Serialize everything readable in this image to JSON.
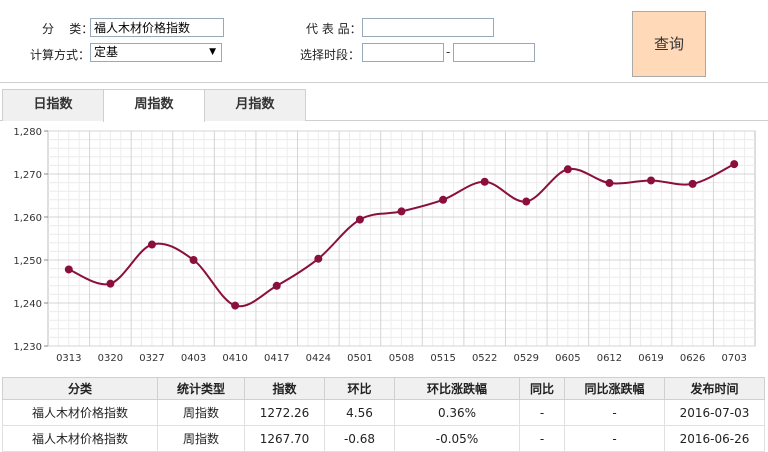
{
  "filters": {
    "category_label": "分    类：",
    "category_value": "福人木材价格指数",
    "method_label": "计算方式：",
    "method_value": "定基",
    "representative_label": "代 表 品：",
    "representative_value": "",
    "period_label": "选择时段：",
    "period_start": "",
    "period_separator": "-",
    "period_end": "",
    "query_button": "查询"
  },
  "tabs": [
    {
      "label": "日指数",
      "active": false
    },
    {
      "label": "周指数",
      "active": true
    },
    {
      "label": "月指数",
      "active": false
    }
  ],
  "colors": {
    "series_line": "#8b0f3c",
    "series_marker": "#8b0f3c",
    "grid": "#d4d4d4",
    "up": "#d9001b",
    "down": "#2f8a2f",
    "query_button_bg": "#ffd9b8"
  },
  "chart_data": {
    "type": "line",
    "x": [
      "0313",
      "0320",
      "0327",
      "0403",
      "0410",
      "0417",
      "0424",
      "0501",
      "0508",
      "0515",
      "0522",
      "0529",
      "0605",
      "0612",
      "0619",
      "0626",
      "0703"
    ],
    "series": [
      {
        "values": [
          1247.8,
          1244.5,
          1253.6,
          1250.0,
          1239.4,
          1244.0,
          1250.3,
          1259.4,
          1261.3,
          1264.0,
          1268.2,
          1263.6,
          1271.1,
          1267.9,
          1268.5,
          1267.7,
          1272.3
        ]
      }
    ],
    "ylim": [
      1230,
      1280
    ],
    "yticks": [
      "1,230",
      "1,240",
      "1,250",
      "1,260",
      "1,270",
      "1,280"
    ],
    "yticks_values": [
      1230,
      1240,
      1250,
      1260,
      1270,
      1280
    ],
    "grid": true,
    "legend": "none"
  },
  "table": {
    "headers": [
      "分类",
      "统计类型",
      "指数",
      "环比",
      "环比涨跌幅",
      "同比",
      "同比涨跌幅",
      "发布时间"
    ],
    "rows": [
      {
        "category": "福人木材价格指数",
        "type": "周指数",
        "index": "1272.26",
        "mom": "4.56",
        "mom_pct": "0.36%",
        "yoy": "-",
        "yoy_pct": "-",
        "date": "2016-07-03",
        "trend": "up"
      },
      {
        "category": "福人木材价格指数",
        "type": "周指数",
        "index": "1267.70",
        "mom": "-0.68",
        "mom_pct": "-0.05%",
        "yoy": "-",
        "yoy_pct": "-",
        "date": "2016-06-26",
        "trend": "down"
      }
    ]
  }
}
